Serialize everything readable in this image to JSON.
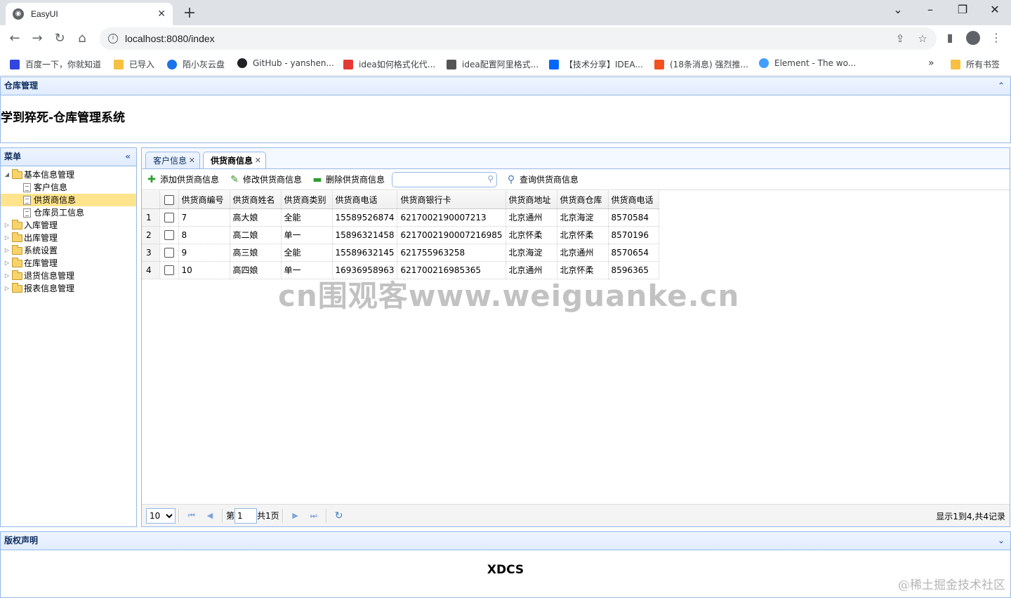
{
  "browser": {
    "tab_title": "EasyUI",
    "url": "localhost:8080/index",
    "bookmarks": [
      {
        "label": "百度一下，你就知道",
        "color": "#3245df"
      },
      {
        "label": "已导入",
        "color": "#f6c142"
      },
      {
        "label": "陌小灰云盘",
        "color": "#1a73e8"
      },
      {
        "label": "GitHub - yanshen...",
        "color": "#202124"
      },
      {
        "label": "idea如何格式化代...",
        "color": "#e53935"
      },
      {
        "label": "idea配置阿里格式...",
        "color": "#555555"
      },
      {
        "label": "【技术分享】IDEA...",
        "color": "#0066ff"
      },
      {
        "label": "(18条消息) 强烈推...",
        "color": "#f4511e"
      },
      {
        "label": "Element - The wo...",
        "color": "#409eff"
      }
    ],
    "all_bookmarks": "所有书签"
  },
  "north": {
    "header": "仓库管理",
    "system_title": "学到猝死-仓库管理系统"
  },
  "menu": {
    "header": "菜单",
    "tree": [
      {
        "label": "基本信息管理",
        "type": "folder",
        "level": 0,
        "expanded": true,
        "selected": false
      },
      {
        "label": "客户信息",
        "type": "file",
        "level": 1,
        "selected": false
      },
      {
        "label": "供货商信息",
        "type": "file",
        "level": 1,
        "selected": true
      },
      {
        "label": "仓库员工信息",
        "type": "file",
        "level": 1,
        "selected": false
      },
      {
        "label": "入库管理",
        "type": "folder",
        "level": 0,
        "expanded": false,
        "selected": false
      },
      {
        "label": "出库管理",
        "type": "folder",
        "level": 0,
        "expanded": false,
        "selected": false
      },
      {
        "label": "系统设置",
        "type": "folder",
        "level": 0,
        "expanded": false,
        "selected": false
      },
      {
        "label": "在库管理",
        "type": "folder",
        "level": 0,
        "expanded": false,
        "selected": false
      },
      {
        "label": "退货信息管理",
        "type": "folder",
        "level": 0,
        "expanded": false,
        "selected": false
      },
      {
        "label": "报表信息管理",
        "type": "folder",
        "level": 0,
        "expanded": false,
        "selected": false
      }
    ]
  },
  "tabs": [
    {
      "label": "客户信息",
      "active": false
    },
    {
      "label": "供货商信息",
      "active": true
    }
  ],
  "toolbar": {
    "add": "添加供货商信息",
    "edit": "修改供货商信息",
    "delete": "删除供货商信息",
    "search_value": "",
    "query": "查询供货商信息"
  },
  "grid": {
    "columns": [
      "供货商编号",
      "供货商姓名",
      "供货商类别",
      "供货商电话",
      "供货商银行卡",
      "供货商地址",
      "供货商仓库",
      "供货商电话"
    ],
    "rows": [
      {
        "rownum": "1",
        "cells": [
          "7",
          "高大娘",
          "全能",
          "15589526874",
          "6217002190007213",
          "北京通州",
          "北京海淀",
          "8570584"
        ]
      },
      {
        "rownum": "2",
        "cells": [
          "8",
          "高二娘",
          "单一",
          "15896321458",
          "6217002190007216985",
          "北京怀柔",
          "北京怀柔",
          "8570196"
        ]
      },
      {
        "rownum": "3",
        "cells": [
          "9",
          "高三娘",
          "全能",
          "15589632145",
          "621755963258",
          "北京海淀",
          "北京通州",
          "8570654"
        ]
      },
      {
        "rownum": "4",
        "cells": [
          "10",
          "高四娘",
          "单一",
          "16936958963",
          "621700216985365",
          "北京通州",
          "北京怀柔",
          "8596365"
        ]
      }
    ]
  },
  "pager": {
    "page_size": "10",
    "page_prefix": "第",
    "page_number": "1",
    "page_total": "共1页",
    "info": "显示1到4,共4记录"
  },
  "south": {
    "header": "版权声明",
    "text": "XDCS"
  },
  "watermark": "cn围观客www.weiguanke.cn",
  "corner_watermark": "@稀土掘金技术社区"
}
